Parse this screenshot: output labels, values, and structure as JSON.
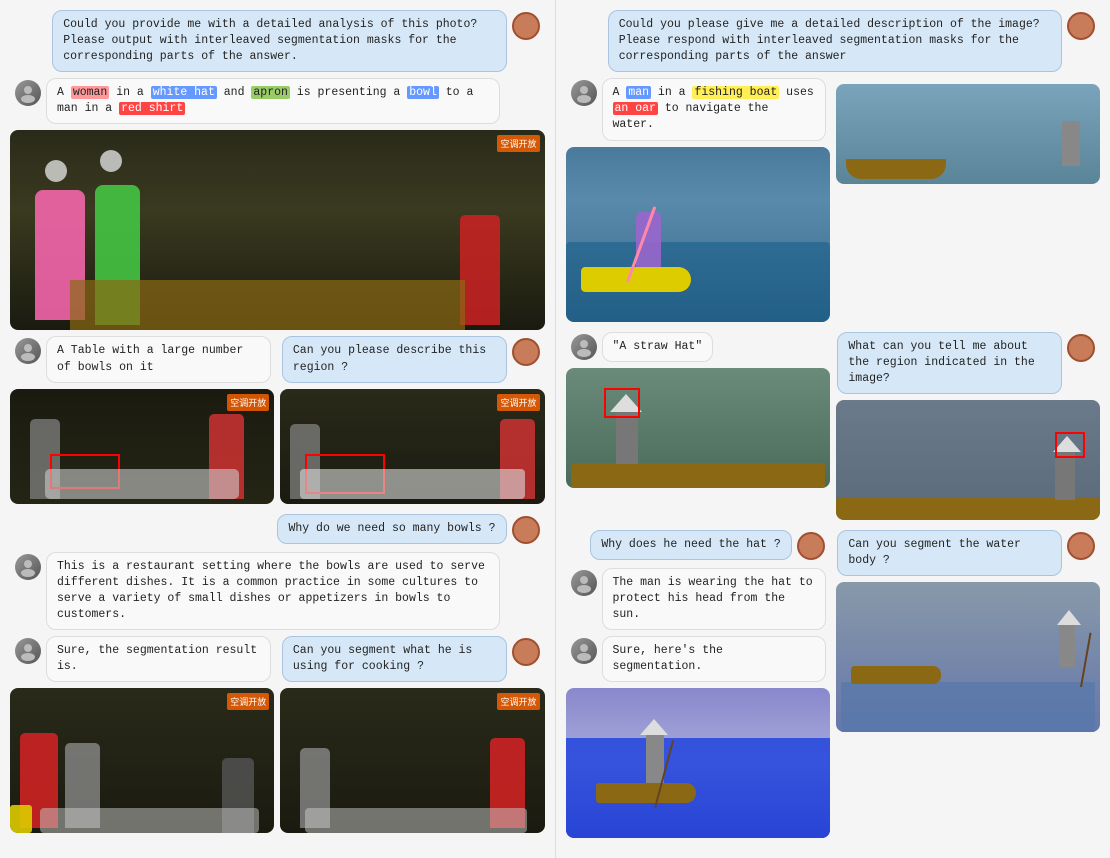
{
  "left_panel": {
    "user_query": "Could you provide me with a detailed analysis of this photo? Please output with interleaved segmentation masks for the corresponding parts of the answer.",
    "bot_response_1": {
      "text_parts": [
        {
          "text": "A ",
          "highlight": null
        },
        {
          "text": "woman",
          "highlight": "pink"
        },
        {
          "text": " in a ",
          "highlight": null
        },
        {
          "text": "white hat",
          "highlight": "blue"
        },
        {
          "text": " and ",
          "highlight": null
        },
        {
          "text": "apron",
          "highlight": "green"
        },
        {
          "text": " is presenting a ",
          "highlight": null
        },
        {
          "text": "bowl",
          "highlight": "blue"
        },
        {
          "text": " to a man in a ",
          "highlight": null
        },
        {
          "text": "red shirt",
          "highlight": "red"
        }
      ]
    },
    "bot_response_2": "A Table with a large number of bowls on it",
    "user_query_2": "Can you please describe this region ?",
    "user_query_3": "Why do we need so many bowls ?",
    "bot_response_3": "This is a restaurant setting where the bowls are used to serve different dishes. It is a common practice in some cultures to serve a variety of small dishes or appetizers in bowls to customers.",
    "bot_response_4": "Sure, the segmentation result is.",
    "user_query_4": "Can you segment what he is using for cooking ?"
  },
  "right_panel": {
    "user_query": "Could you please give me a detailed description of the image? Please respond with interleaved segmentation masks for the corresponding parts of the answer",
    "bot_response_1": {
      "text_parts": [
        {
          "text": "A ",
          "highlight": null
        },
        {
          "text": "man",
          "highlight": "blue"
        },
        {
          "text": " in a ",
          "highlight": null
        },
        {
          "text": "fishing boat",
          "highlight": "yellow"
        },
        {
          "text": " uses ",
          "highlight": null
        },
        {
          "text": "an oar",
          "highlight": "red"
        },
        {
          "text": " to navigate the water.",
          "highlight": null
        }
      ]
    },
    "user_query_2": "What can you tell me about the region indicated in the image?",
    "bot_response_2": "\"A straw Hat\"",
    "user_query_3": "Why does he need the hat ?",
    "bot_response_3": "The man is wearing the hat to protect his head from the sun.",
    "user_query_4": "Can you segment the water body ?",
    "bot_response_4": "Sure, here's the segmentation."
  },
  "icons": {
    "user": "👤",
    "bot": "🤖"
  }
}
